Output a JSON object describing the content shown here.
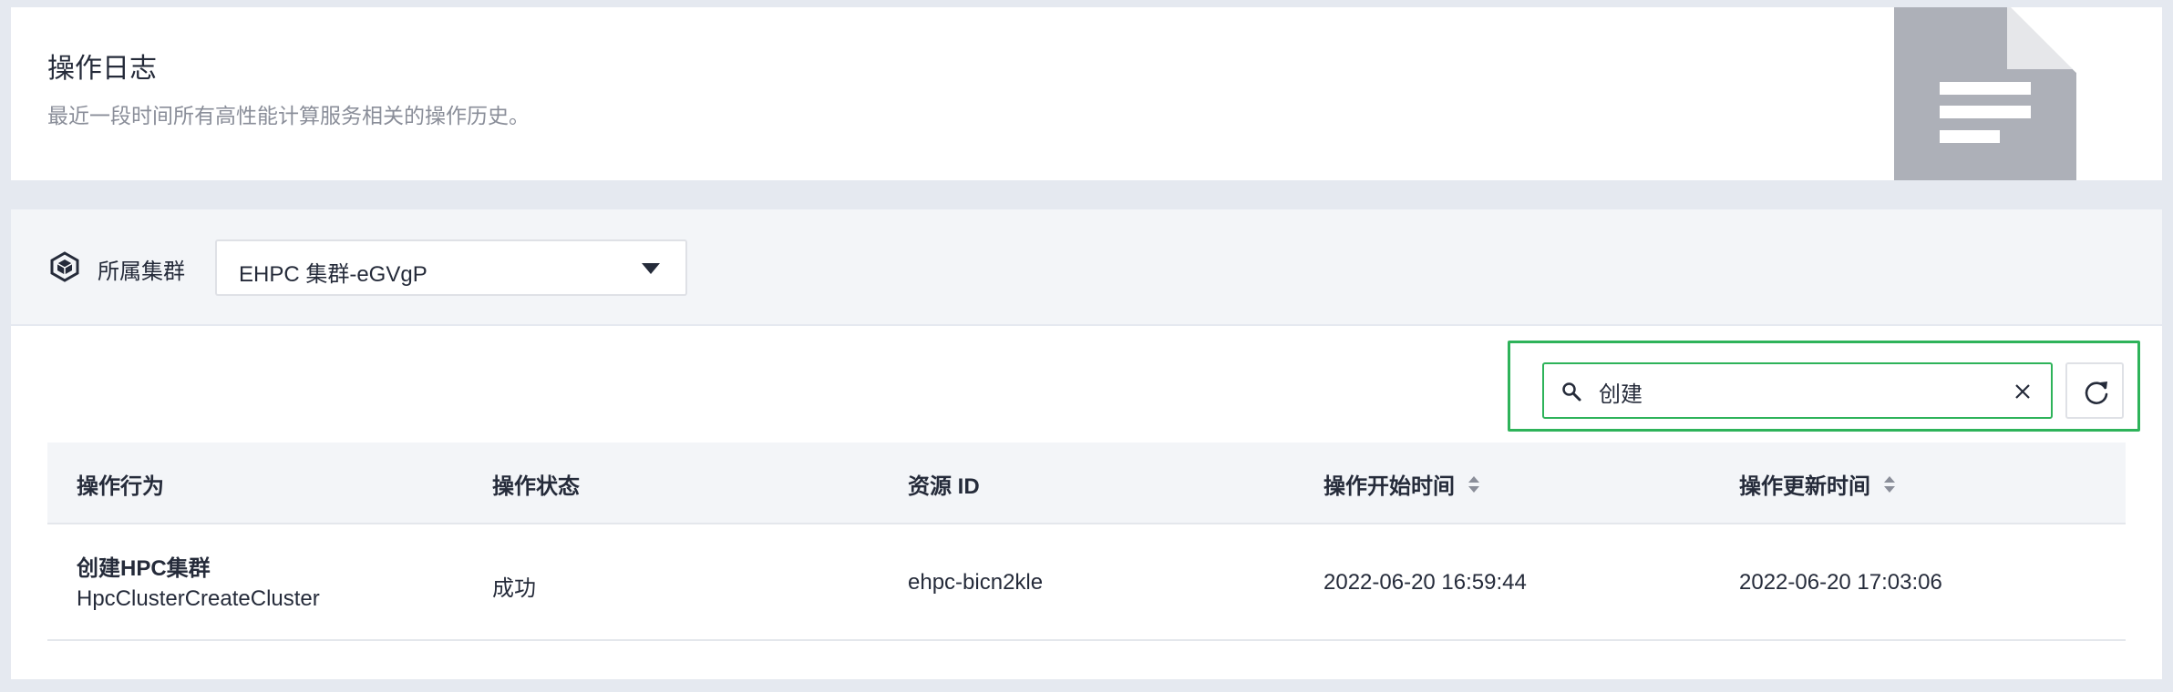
{
  "header": {
    "title": "操作日志",
    "subtitle": "最近一段时间所有高性能计算服务相关的操作历史。"
  },
  "filter": {
    "cluster_label": "所属集群",
    "cluster_value": "EHPC 集群-eGVgP"
  },
  "search": {
    "value": "创建"
  },
  "table": {
    "columns": [
      "操作行为",
      "操作状态",
      "资源 ID",
      "操作开始时间",
      "操作更新时间"
    ],
    "rows": [
      {
        "action_cn": "创建HPC集群",
        "action_en": "HpcClusterCreateCluster",
        "status": "成功",
        "resource_id": "ehpc-bicn2kle",
        "start_time": "2022-06-20 16:59:44",
        "update_time": "2022-06-20 17:03:06"
      }
    ]
  },
  "icons": {
    "cluster": "cube-icon",
    "dropdown": "caret-down-icon",
    "search": "search-icon",
    "clear": "close-icon",
    "refresh": "refresh-icon",
    "sort": "sort-icon",
    "illustration": "document-icon"
  },
  "colors": {
    "highlight": "#2eb35a",
    "text": "#252b3a",
    "muted": "#8a8e99",
    "background": "#e5e9f0",
    "illustration": "#adb0b8"
  }
}
